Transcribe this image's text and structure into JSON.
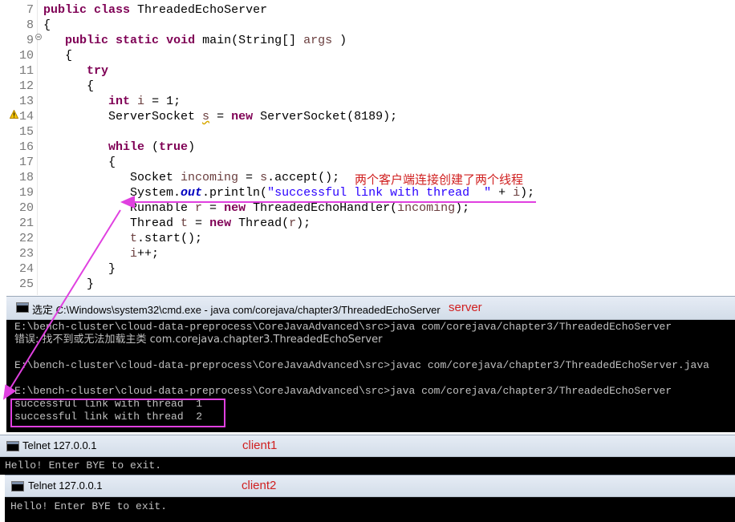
{
  "editor": {
    "lines": [
      {
        "num": "7",
        "segs": [
          [
            "kw",
            "public"
          ],
          [
            "t",
            " "
          ],
          [
            "kw",
            "class"
          ],
          [
            "t",
            " ThreadedEchoServer"
          ]
        ]
      },
      {
        "num": "8",
        "segs": [
          [
            "t",
            "{"
          ]
        ]
      },
      {
        "num": "9",
        "segs": [
          [
            "t",
            "   "
          ],
          [
            "kw",
            "public"
          ],
          [
            "t",
            " "
          ],
          [
            "kw",
            "static"
          ],
          [
            "t",
            " "
          ],
          [
            "kw",
            "void"
          ],
          [
            "t",
            " main(String[] "
          ],
          [
            "var",
            "args"
          ],
          [
            "t",
            " )"
          ]
        ]
      },
      {
        "num": "10",
        "segs": [
          [
            "t",
            "   {"
          ]
        ]
      },
      {
        "num": "11",
        "segs": [
          [
            "t",
            "      "
          ],
          [
            "kw",
            "try"
          ]
        ]
      },
      {
        "num": "12",
        "segs": [
          [
            "t",
            "      {"
          ]
        ]
      },
      {
        "num": "13",
        "segs": [
          [
            "t",
            "         "
          ],
          [
            "kw",
            "int"
          ],
          [
            "t",
            " "
          ],
          [
            "var",
            "i"
          ],
          [
            "t",
            " = 1;"
          ]
        ]
      },
      {
        "num": "14",
        "segs": [
          [
            "t",
            "         ServerSocket "
          ],
          [
            "warnvar",
            "s"
          ],
          [
            "t",
            " = "
          ],
          [
            "kw",
            "new"
          ],
          [
            "t",
            " ServerSocket(8189);"
          ]
        ]
      },
      {
        "num": "15",
        "segs": []
      },
      {
        "num": "16",
        "segs": [
          [
            "t",
            "         "
          ],
          [
            "kw",
            "while"
          ],
          [
            "t",
            " ("
          ],
          [
            "kw",
            "true"
          ],
          [
            "t",
            ")"
          ]
        ]
      },
      {
        "num": "17",
        "segs": [
          [
            "t",
            "         {"
          ]
        ]
      },
      {
        "num": "18",
        "segs": [
          [
            "t",
            "            Socket "
          ],
          [
            "var",
            "incoming"
          ],
          [
            "t",
            " = "
          ],
          [
            "var",
            "s"
          ],
          [
            "t",
            ".accept();"
          ]
        ]
      },
      {
        "num": "19",
        "segs": [
          [
            "t",
            "            System."
          ],
          [
            "fld",
            "out"
          ],
          [
            "t",
            ".println("
          ],
          [
            "str",
            "\"successful link with thread  \""
          ],
          [
            "t",
            " + "
          ],
          [
            "var",
            "i"
          ],
          [
            "t",
            ");"
          ]
        ]
      },
      {
        "num": "20",
        "segs": [
          [
            "t",
            "            Runnable "
          ],
          [
            "var",
            "r"
          ],
          [
            "t",
            " = "
          ],
          [
            "kw",
            "new"
          ],
          [
            "t",
            " ThreadedEchoHandler("
          ],
          [
            "var",
            "incoming"
          ],
          [
            "t",
            ");"
          ]
        ]
      },
      {
        "num": "21",
        "segs": [
          [
            "t",
            "            Thread "
          ],
          [
            "var",
            "t"
          ],
          [
            "t",
            " = "
          ],
          [
            "kw",
            "new"
          ],
          [
            "t",
            " Thread("
          ],
          [
            "var",
            "r"
          ],
          [
            "t",
            ");"
          ]
        ]
      },
      {
        "num": "22",
        "segs": [
          [
            "t",
            "            "
          ],
          [
            "var",
            "t"
          ],
          [
            "t",
            ".start();"
          ]
        ]
      },
      {
        "num": "23",
        "segs": [
          [
            "t",
            "            "
          ],
          [
            "var",
            "i"
          ],
          [
            "t",
            "++;"
          ]
        ]
      },
      {
        "num": "24",
        "segs": [
          [
            "t",
            "         }"
          ]
        ]
      },
      {
        "num": "25",
        "segs": [
          [
            "t",
            "      }"
          ]
        ]
      }
    ]
  },
  "annotation_cn": "两个客户端连接创建了两个线程",
  "server_window": {
    "title": "选定 C:\\Windows\\system32\\cmd.exe - java  com/corejava/chapter3/ThreadedEchoServer",
    "label": "server",
    "lines": [
      "E:\\bench-cluster\\cloud-data-preprocess\\CoreJavaAdvanced\\src>java com/corejava/chapter3/ThreadedEchoServer",
      "错误: 找不到或无法加载主类 com.corejava.chapter3.ThreadedEchoServer",
      "",
      "E:\\bench-cluster\\cloud-data-preprocess\\CoreJavaAdvanced\\src>javac com/corejava/chapter3/ThreadedEchoServer.java",
      "",
      "E:\\bench-cluster\\cloud-data-preprocess\\CoreJavaAdvanced\\src>java com/corejava/chapter3/ThreadedEchoServer",
      "successful link with thread  1",
      "successful link with thread  2"
    ]
  },
  "client1_window": {
    "title": "Telnet 127.0.0.1",
    "label": "client1",
    "line": "Hello! Enter BYE to exit."
  },
  "client2_window": {
    "title": "Telnet 127.0.0.1",
    "label": "client2",
    "line": "Hello! Enter BYE to exit."
  },
  "colors": {
    "keyword": "#7f0055",
    "string": "#2a00ff",
    "annotation_red": "#d02020",
    "highlight_magenta": "#e040e0",
    "console_bg": "#000000",
    "console_fg": "#c0c0c0"
  }
}
